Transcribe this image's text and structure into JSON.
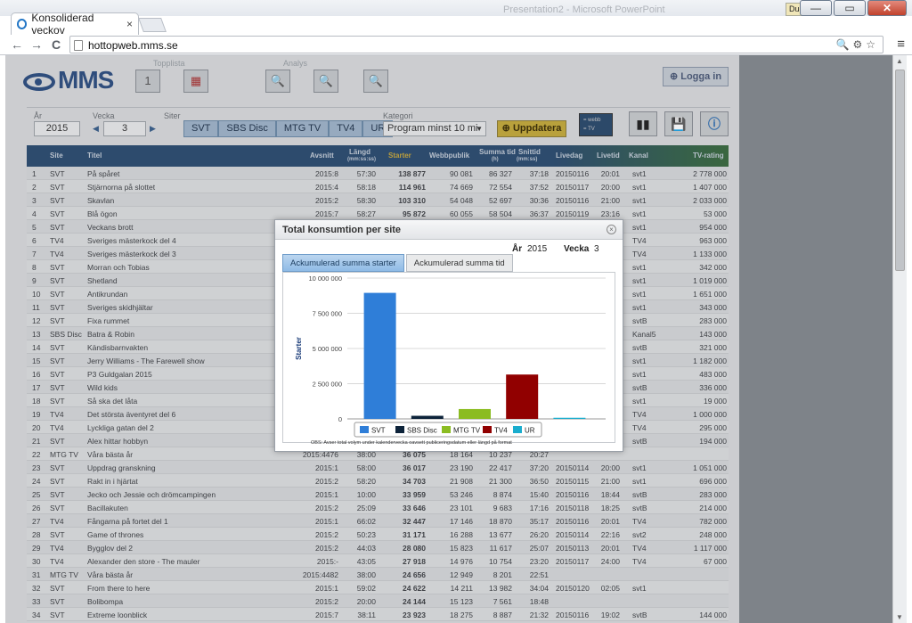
{
  "browser": {
    "tab_title": "Konsoliderad veckov",
    "tab_close": "×",
    "url": "hottopweb.mms.se",
    "back_glyph": "←",
    "forward_glyph": "→",
    "reload_glyph": "C",
    "menu_glyph": "≡",
    "window_buttons": [
      "—",
      "▭",
      "✕"
    ],
    "badge": "Du",
    "bg_title": "Presentation2 - Microsoft PowerPoint"
  },
  "header": {
    "logo": "MMS",
    "labels": {
      "topplista": "Topplista",
      "analys": "Analys"
    },
    "calendar_day": "1",
    "login_label": "Logga in"
  },
  "filters": {
    "year_label": "År",
    "year_value": "2015",
    "week_label": "Vecka",
    "week_value": "3",
    "sites_label": "Siter",
    "sites": [
      "SVT",
      "SBS Disc",
      "MTG TV",
      "TV4",
      "UR"
    ],
    "category_label": "Kategori",
    "category_value": "Program minst 10 mi",
    "update_label": "Uppdatera",
    "legend_mini": [
      "= webb",
      "= TV"
    ]
  },
  "table": {
    "headers": {
      "site": "Site",
      "titel": "Titel",
      "avsnitt": "Avsnitt",
      "langd": "Längd",
      "langd_sub": "(mm:ss:ss)",
      "starter": "Starter",
      "webbpublik": "Webbpublik",
      "summa_tid": "Summa tid",
      "summa_tid_sub": "(h)",
      "snittid": "Snittid",
      "snittid_sub": "(mm:ss)",
      "livedag": "Livedag",
      "livetid": "Livetid",
      "kanal": "Kanal",
      "tvrating": "TV-rating"
    },
    "rows": [
      {
        "n": "1",
        "site": "SVT",
        "titel": "På spåret",
        "avsnitt": "2015:8",
        "langd": "57:30",
        "starter": "138 877",
        "webb": "90 081",
        "summa": "86 327",
        "snitt": "37:18",
        "livedag": "20150116",
        "livetid": "20:01",
        "kanal": "svt1",
        "tv": "2 778 000"
      },
      {
        "n": "2",
        "site": "SVT",
        "titel": "Stjärnorna på slottet",
        "avsnitt": "2015:4",
        "langd": "58:18",
        "starter": "114 961",
        "webb": "74 669",
        "summa": "72 554",
        "snitt": "37:52",
        "livedag": "20150117",
        "livetid": "20:00",
        "kanal": "svt1",
        "tv": "1 407 000"
      },
      {
        "n": "3",
        "site": "SVT",
        "titel": "Skavlan",
        "avsnitt": "2015:2",
        "langd": "58:30",
        "starter": "103 310",
        "webb": "54 048",
        "summa": "52 697",
        "snitt": "30:36",
        "livedag": "20150116",
        "livetid": "21:00",
        "kanal": "svt1",
        "tv": "2 033 000"
      },
      {
        "n": "4",
        "site": "SVT",
        "titel": "Blå ögon",
        "avsnitt": "2015:7",
        "langd": "58:27",
        "starter": "95 872",
        "webb": "60 055",
        "summa": "58 504",
        "snitt": "36:37",
        "livedag": "20150119",
        "livetid": "23:16",
        "kanal": "svt1",
        "tv": "53 000"
      },
      {
        "n": "5",
        "site": "SVT",
        "titel": "Veckans brott",
        "avsnitt": "",
        "langd": "",
        "starter": "",
        "webb": "",
        "summa": "",
        "snitt": "",
        "livedag": "",
        "livetid": "",
        "kanal": "svt1",
        "tv": "954 000"
      },
      {
        "n": "6",
        "site": "TV4",
        "titel": "Sveriges mästerkock del 4",
        "avsnitt": "",
        "langd": "",
        "starter": "",
        "webb": "",
        "summa": "",
        "snitt": "",
        "livedag": "",
        "livetid": "",
        "kanal": "TV4",
        "tv": "963 000"
      },
      {
        "n": "7",
        "site": "TV4",
        "titel": "Sveriges mästerkock del 3",
        "avsnitt": "",
        "langd": "",
        "starter": "",
        "webb": "",
        "summa": "",
        "snitt": "",
        "livedag": "",
        "livetid": "",
        "kanal": "TV4",
        "tv": "1 133 000"
      },
      {
        "n": "8",
        "site": "SVT",
        "titel": "Morran och Tobias",
        "avsnitt": "",
        "langd": "",
        "starter": "",
        "webb": "",
        "summa": "",
        "snitt": "",
        "livedag": "",
        "livetid": "",
        "kanal": "svt1",
        "tv": "342 000"
      },
      {
        "n": "9",
        "site": "SVT",
        "titel": "Shetland",
        "avsnitt": "",
        "langd": "",
        "starter": "",
        "webb": "",
        "summa": "",
        "snitt": "",
        "livedag": "",
        "livetid": "",
        "kanal": "svt1",
        "tv": "1 019 000"
      },
      {
        "n": "10",
        "site": "SVT",
        "titel": "Antikrundan",
        "avsnitt": "",
        "langd": "",
        "starter": "",
        "webb": "",
        "summa": "",
        "snitt": "",
        "livedag": "",
        "livetid": "",
        "kanal": "svt1",
        "tv": "1 651 000"
      },
      {
        "n": "11",
        "site": "SVT",
        "titel": "Sveriges skidhjältar",
        "avsnitt": "",
        "langd": "",
        "starter": "",
        "webb": "",
        "summa": "",
        "snitt": "",
        "livedag": "",
        "livetid": "",
        "kanal": "svt1",
        "tv": "343 000"
      },
      {
        "n": "12",
        "site": "SVT",
        "titel": "Fixa rummet",
        "avsnitt": "",
        "langd": "",
        "starter": "",
        "webb": "",
        "summa": "",
        "snitt": "",
        "livedag": "",
        "livetid": "",
        "kanal": "svtB",
        "tv": "283 000"
      },
      {
        "n": "13",
        "site": "SBS Disc",
        "titel": "Batra & Robin",
        "avsnitt": "",
        "langd": "",
        "starter": "",
        "webb": "",
        "summa": "",
        "snitt": "",
        "livedag": "",
        "livetid": "",
        "kanal": "Kanal5",
        "tv": "143 000"
      },
      {
        "n": "14",
        "site": "SVT",
        "titel": "Kändisbarnvakten",
        "avsnitt": "",
        "langd": "",
        "starter": "",
        "webb": "",
        "summa": "",
        "snitt": "",
        "livedag": "",
        "livetid": "",
        "kanal": "svtB",
        "tv": "321 000"
      },
      {
        "n": "15",
        "site": "SVT",
        "titel": "Jerry Williams - The Farewell show",
        "avsnitt": "",
        "langd": "",
        "starter": "",
        "webb": "",
        "summa": "",
        "snitt": "",
        "livedag": "",
        "livetid": "",
        "kanal": "svt1",
        "tv": "1 182 000"
      },
      {
        "n": "16",
        "site": "SVT",
        "titel": "P3 Guldgalan 2015",
        "avsnitt": "",
        "langd": "",
        "starter": "",
        "webb": "",
        "summa": "",
        "snitt": "",
        "livedag": "",
        "livetid": "",
        "kanal": "svt1",
        "tv": "483 000"
      },
      {
        "n": "17",
        "site": "SVT",
        "titel": "Wild kids",
        "avsnitt": "",
        "langd": "",
        "starter": "",
        "webb": "",
        "summa": "",
        "snitt": "",
        "livedag": "",
        "livetid": "",
        "kanal": "svtB",
        "tv": "336 000"
      },
      {
        "n": "18",
        "site": "SVT",
        "titel": "Så ska det låta",
        "avsnitt": "",
        "langd": "",
        "starter": "",
        "webb": "",
        "summa": "",
        "snitt": "",
        "livedag": "",
        "livetid": "",
        "kanal": "svt1",
        "tv": "19 000"
      },
      {
        "n": "19",
        "site": "TV4",
        "titel": "Det största äventyret del 6",
        "avsnitt": "",
        "langd": "",
        "starter": "",
        "webb": "",
        "summa": "",
        "snitt": "",
        "livedag": "",
        "livetid": "",
        "kanal": "TV4",
        "tv": "1 000 000"
      },
      {
        "n": "20",
        "site": "TV4",
        "titel": "Lyckliga gatan del 2",
        "avsnitt": "",
        "langd": "",
        "starter": "",
        "webb": "",
        "summa": "",
        "snitt": "",
        "livedag": "",
        "livetid": "",
        "kanal": "TV4",
        "tv": "295 000"
      },
      {
        "n": "21",
        "site": "SVT",
        "titel": "Alex hittar hobbyn",
        "avsnitt": "",
        "langd": "",
        "starter": "",
        "webb": "",
        "summa": "",
        "snitt": "",
        "livedag": "",
        "livetid": "",
        "kanal": "svtB",
        "tv": "194 000"
      },
      {
        "n": "22",
        "site": "MTG TV",
        "titel": "Våra bästa år",
        "avsnitt": "2015:4476",
        "langd": "38:00",
        "starter": "36 075",
        "webb": "18 164",
        "summa": "10 237",
        "snitt": "20:27",
        "livedag": "",
        "livetid": "",
        "kanal": "",
        "tv": ""
      },
      {
        "n": "23",
        "site": "SVT",
        "titel": "Uppdrag granskning",
        "avsnitt": "2015:1",
        "langd": "58:00",
        "starter": "36 017",
        "webb": "23 190",
        "summa": "22 417",
        "snitt": "37:20",
        "livedag": "20150114",
        "livetid": "20:00",
        "kanal": "svt1",
        "tv": "1 051 000"
      },
      {
        "n": "24",
        "site": "SVT",
        "titel": "Rakt in i hjärtat",
        "avsnitt": "2015:2",
        "langd": "58:20",
        "starter": "34 703",
        "webb": "21 908",
        "summa": "21 300",
        "snitt": "36:50",
        "livedag": "20150115",
        "livetid": "21:00",
        "kanal": "svt1",
        "tv": "696 000"
      },
      {
        "n": "25",
        "site": "SVT",
        "titel": "Jecko och Jessie och drömcampingen",
        "avsnitt": "2015:1",
        "langd": "10:00",
        "starter": "33 959",
        "webb": "53 246",
        "summa": "8 874",
        "snitt": "15:40",
        "livedag": "20150116",
        "livetid": "18:44",
        "kanal": "svtB",
        "tv": "283 000"
      },
      {
        "n": "26",
        "site": "SVT",
        "titel": "Bacillakuten",
        "avsnitt": "2015:2",
        "langd": "25:09",
        "starter": "33 646",
        "webb": "23 101",
        "summa": "9 683",
        "snitt": "17:16",
        "livedag": "20150118",
        "livetid": "18:25",
        "kanal": "svtB",
        "tv": "214 000"
      },
      {
        "n": "27",
        "site": "TV4",
        "titel": "Fångarna på fortet del 1",
        "avsnitt": "2015:1",
        "langd": "66:02",
        "starter": "32 447",
        "webb": "17 146",
        "summa": "18 870",
        "snitt": "35:17",
        "livedag": "20150116",
        "livetid": "20:01",
        "kanal": "TV4",
        "tv": "782 000"
      },
      {
        "n": "28",
        "site": "SVT",
        "titel": "Game of thrones",
        "avsnitt": "2015:2",
        "langd": "50:23",
        "starter": "31 171",
        "webb": "16 288",
        "summa": "13 677",
        "snitt": "26:20",
        "livedag": "20150114",
        "livetid": "22:16",
        "kanal": "svt2",
        "tv": "248 000"
      },
      {
        "n": "29",
        "site": "TV4",
        "titel": "Bygglov del 2",
        "avsnitt": "2015:2",
        "langd": "44:03",
        "starter": "28 080",
        "webb": "15 823",
        "summa": "11 617",
        "snitt": "25:07",
        "livedag": "20150113",
        "livetid": "20:01",
        "kanal": "TV4",
        "tv": "1 117 000"
      },
      {
        "n": "30",
        "site": "TV4",
        "titel": "Alexander den store - The mauler",
        "avsnitt": "2015:-",
        "langd": "43:05",
        "starter": "27 918",
        "webb": "14 976",
        "summa": "10 754",
        "snitt": "23:20",
        "livedag": "20150117",
        "livetid": "24:00",
        "kanal": "TV4",
        "tv": "67 000"
      },
      {
        "n": "31",
        "site": "MTG TV",
        "titel": "Våra bästa år",
        "avsnitt": "2015:4482",
        "langd": "38:00",
        "starter": "24 656",
        "webb": "12 949",
        "summa": "8 201",
        "snitt": "22:51",
        "livedag": "",
        "livetid": "",
        "kanal": "",
        "tv": ""
      },
      {
        "n": "32",
        "site": "SVT",
        "titel": "From there to here",
        "avsnitt": "2015:1",
        "langd": "59:02",
        "starter": "24 622",
        "webb": "14 211",
        "summa": "13 982",
        "snitt": "34:04",
        "livedag": "20150120",
        "livetid": "02:05",
        "kanal": "svt1",
        "tv": ""
      },
      {
        "n": "33",
        "site": "SVT",
        "titel": "Bolibompa",
        "avsnitt": "2015:2",
        "langd": "20:00",
        "starter": "24 144",
        "webb": "15 123",
        "summa": "7 561",
        "snitt": "18:48",
        "livedag": "",
        "livetid": "",
        "kanal": "",
        "tv": ""
      },
      {
        "n": "34",
        "site": "SVT",
        "titel": "Extreme loonblick",
        "avsnitt": "2015:7",
        "langd": "38:11",
        "starter": "23 923",
        "webb": "18 275",
        "summa": "8 887",
        "snitt": "21:32",
        "livedag": "20150116",
        "livetid": "19:02",
        "kanal": "svtB",
        "tv": "144 000"
      }
    ]
  },
  "modal": {
    "title": "Total konsumtion per site",
    "close_glyph": "×",
    "year_label": "År",
    "year_value": "2015",
    "week_label": "Vecka",
    "week_value": "3",
    "tabs": [
      "Ackumulerad summa starter",
      "Ackumulerad summa tid"
    ],
    "note": "OBS: Avser total volym under kalendervecka oavsett publiceringsdatum eller längd på format"
  },
  "chart_data": {
    "type": "bar",
    "categories": [
      "SVT",
      "SBS Disc",
      "MTG TV",
      "TV4",
      "UR"
    ],
    "values": [
      8950000,
      220000,
      700000,
      3150000,
      80000
    ],
    "colors": [
      "#2f7ed8",
      "#0d233a",
      "#8bbc21",
      "#910000",
      "#1aadce"
    ],
    "ylabel": "Starter",
    "ylim": [
      0,
      10000000
    ],
    "yticks": [
      "0",
      "2 500 000",
      "5 000 000",
      "7 500 000",
      "10 000 000"
    ],
    "ytick_values": [
      0,
      2500000,
      5000000,
      7500000,
      10000000
    ],
    "legend_position": "bottom",
    "grid": true
  }
}
